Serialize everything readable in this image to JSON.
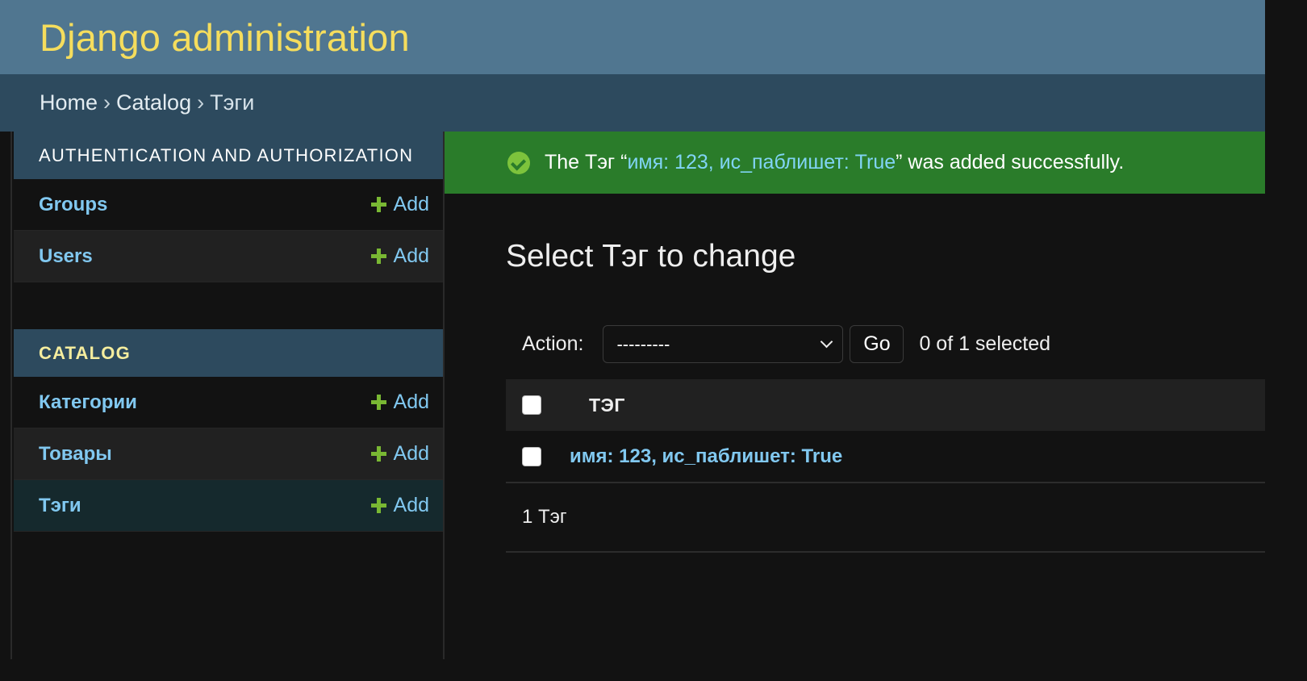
{
  "header": {
    "brand": "Django administration"
  },
  "breadcrumbs": {
    "home": "Home",
    "separator": "›",
    "app": "Catalog",
    "current": "Тэги"
  },
  "sidebar": {
    "modules": [
      {
        "caption": "AUTHENTICATION AND AUTHORIZATION",
        "models": [
          {
            "name": "Groups",
            "add_label": "Add"
          },
          {
            "name": "Users",
            "add_label": "Add"
          }
        ]
      },
      {
        "caption": "CATALOG",
        "models": [
          {
            "name": "Категории",
            "add_label": "Add"
          },
          {
            "name": "Товары",
            "add_label": "Add"
          },
          {
            "name": "Тэги",
            "add_label": "Add",
            "current": true
          }
        ]
      }
    ]
  },
  "message": {
    "prefix": "The Тэг “",
    "object_link": "имя: 123, ис_паблишет: True",
    "suffix": "” was added successfully.",
    "icon": "check-circle-icon",
    "color": "#2a7c2a"
  },
  "content": {
    "title": "Select Тэг to change",
    "actions": {
      "label": "Action:",
      "selected_value": "---------",
      "go_label": "Go",
      "counter": "0 of 1 selected"
    },
    "table": {
      "column_header": "ТЭГ",
      "rows": [
        {
          "value": "имя: 123, ис_паблишет: True",
          "checked": false
        }
      ]
    },
    "paginator": "1 Тэг"
  },
  "colors": {
    "header_bg": "#507690",
    "brand_text": "#f5dd5d",
    "breadcrumbs_bg": "#2d4a5e",
    "link": "#81c8f0",
    "add_plus": "#79b833",
    "page_bg": "#121212"
  }
}
